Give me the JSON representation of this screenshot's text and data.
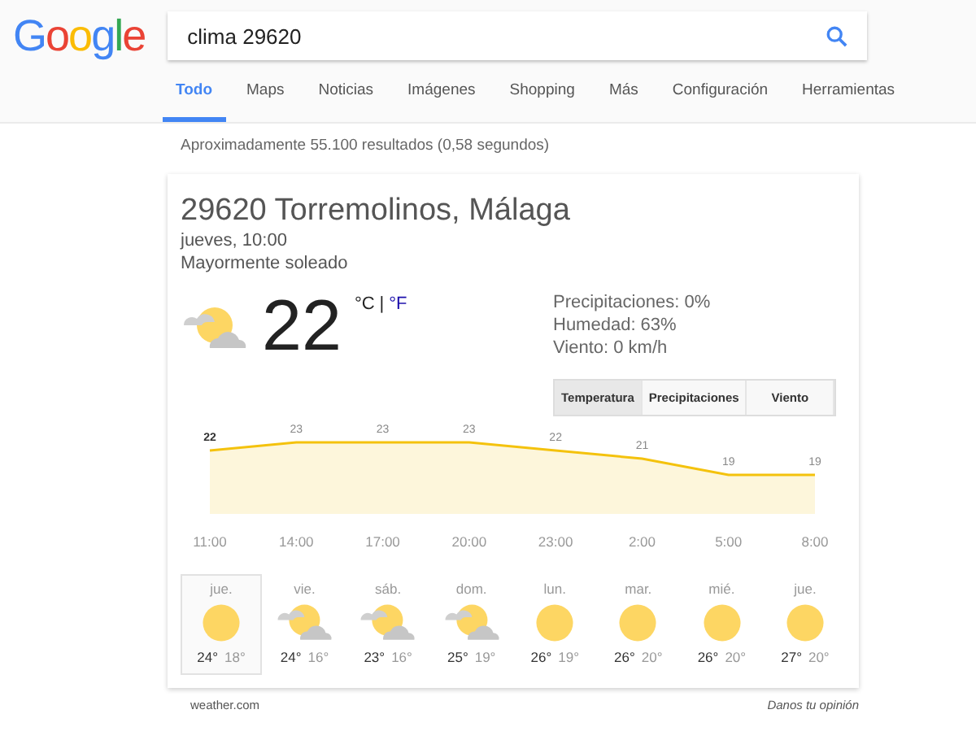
{
  "logo": "Google",
  "search": {
    "value": "clima 29620"
  },
  "tabs": [
    {
      "label": "Todo",
      "selected": true
    },
    {
      "label": "Maps",
      "selected": false
    },
    {
      "label": "Noticias",
      "selected": false
    },
    {
      "label": "Imágenes",
      "selected": false
    },
    {
      "label": "Shopping",
      "selected": false
    },
    {
      "label": "Más",
      "selected": false
    },
    {
      "label": "Configuración",
      "selected": false
    },
    {
      "label": "Herramientas",
      "selected": false
    }
  ],
  "result_stats": "Aproximadamente 55.100 resultados (0,58 segundos)",
  "weather": {
    "location": "29620 Torremolinos, Málaga",
    "time": "jueves, 10:00",
    "condition": "Mayormente soleado",
    "current": {
      "kind": "partly_cloudy"
    },
    "temperature": "22",
    "units": [
      {
        "label": "°C",
        "selected": true
      },
      {
        "label": "°F",
        "selected": false
      }
    ],
    "unit_separator": "|",
    "details": [
      "Precipitaciones: 0%",
      "Humedad: 63%",
      "Viento: 0 km/h"
    ],
    "modes": [
      {
        "label": "Temperatura",
        "selected": true
      },
      {
        "label": "Precipitaciones",
        "selected": false
      },
      {
        "label": "Viento",
        "selected": false
      }
    ],
    "chart_data": {
      "type": "area",
      "categories": [
        "11:00",
        "14:00",
        "17:00",
        "20:00",
        "23:00",
        "2:00",
        "5:00",
        "8:00"
      ],
      "series": [
        {
          "color": "#f4c20d",
          "values": [
            22,
            23,
            23,
            23,
            22,
            21,
            19,
            19
          ]
        }
      ],
      "data_labels": true
    },
    "forecast": [
      {
        "day": "jue.",
        "kind": "sunny",
        "high": "24°",
        "low": "18°",
        "selected": true
      },
      {
        "day": "vie.",
        "kind": "partly_cloudy",
        "high": "24°",
        "low": "16°",
        "selected": false
      },
      {
        "day": "sáb.",
        "kind": "partly_cloudy",
        "high": "23°",
        "low": "16°",
        "selected": false
      },
      {
        "day": "dom.",
        "kind": "partly_cloudy",
        "high": "25°",
        "low": "19°",
        "selected": false
      },
      {
        "day": "lun.",
        "kind": "sunny",
        "high": "26°",
        "low": "19°",
        "selected": false
      },
      {
        "day": "mar.",
        "kind": "sunny",
        "high": "26°",
        "low": "20°",
        "selected": false
      },
      {
        "day": "mié.",
        "kind": "sunny",
        "high": "26°",
        "low": "20°",
        "selected": false
      },
      {
        "day": "jue.",
        "kind": "sunny",
        "high": "27°",
        "low": "20°",
        "selected": false
      }
    ]
  },
  "footer": {
    "source": "weather.com",
    "feedback": "Danos tu opinión"
  }
}
